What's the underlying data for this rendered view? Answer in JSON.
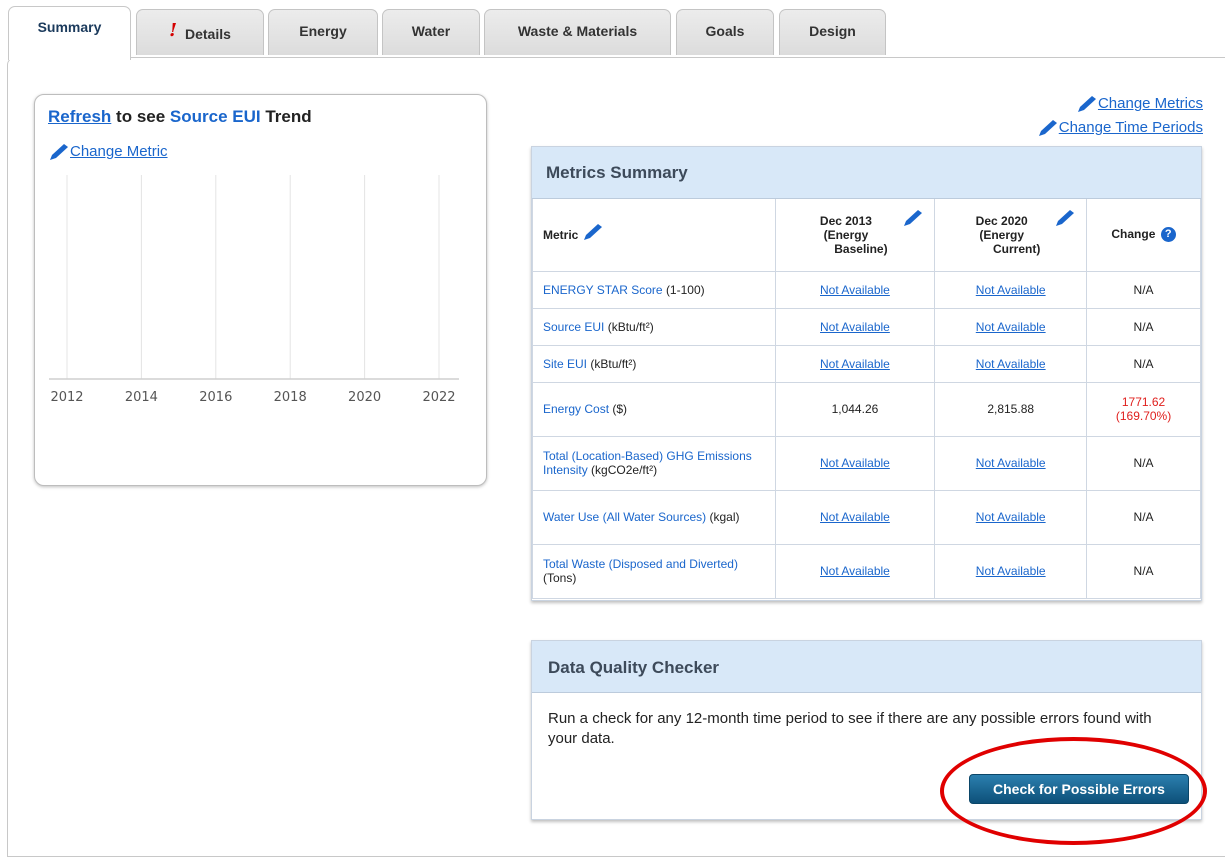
{
  "tabs": [
    {
      "label": "Summary",
      "active": true
    },
    {
      "label": "Details",
      "warning": "!"
    },
    {
      "label": "Energy"
    },
    {
      "label": "Water"
    },
    {
      "label": "Waste & Materials"
    },
    {
      "label": "Goals"
    },
    {
      "label": "Design"
    }
  ],
  "trend": {
    "refresh_link": "Refresh",
    "title_mid": "to see",
    "metric_name": "Source EUI",
    "title_end": "Trend",
    "change_metric": "Change Metric"
  },
  "chart_data": {
    "type": "line",
    "x_ticks": [
      "2012",
      "2014",
      "2016",
      "2018",
      "2020",
      "2022"
    ],
    "series": [],
    "grid": true
  },
  "top_links": {
    "change_metrics": "Change Metrics",
    "change_time_periods": "Change Time Periods"
  },
  "metrics_summary": {
    "title": "Metrics Summary",
    "headers": {
      "metric": "Metric",
      "baseline": [
        "Dec 2013",
        "(Energy",
        "Baseline)"
      ],
      "current": [
        "Dec 2020",
        "(Energy",
        "Current)"
      ],
      "change": "Change"
    },
    "rows": [
      {
        "name": "ENERGY STAR Score",
        "unit": "(1-100)",
        "baseline": "Not Available",
        "current": "Not Available",
        "change": "N/A"
      },
      {
        "name": "Source EUI",
        "unit": "(kBtu/ft²)",
        "baseline": "Not Available",
        "current": "Not Available",
        "change": "N/A"
      },
      {
        "name": "Site EUI",
        "unit": "(kBtu/ft²)",
        "baseline": "Not Available",
        "current": "Not Available",
        "change": "N/A"
      },
      {
        "name": "Energy Cost",
        "unit": "($)",
        "baseline": "1,044.26",
        "current": "2,815.88",
        "change_line1": "1771.62",
        "change_line2": "(169.70%)"
      },
      {
        "name": "Total (Location-Based) GHG Emissions Intensity",
        "unit": "(kgCO2e/ft²)",
        "baseline": "Not Available",
        "current": "Not Available",
        "change": "N/A"
      },
      {
        "name": "Water Use (All Water Sources)",
        "unit": "(kgal)",
        "baseline": "Not Available",
        "current": "Not Available",
        "change": "N/A"
      },
      {
        "name": "Total Waste (Disposed and Diverted)",
        "unit": "(Tons)",
        "baseline": "Not Available",
        "current": "Not Available",
        "change": "N/A"
      }
    ]
  },
  "data_quality": {
    "title": "Data Quality Checker",
    "description": "Run a check for any 12-month time period to see if there are any possible errors found with your data.",
    "button": "Check for Possible Errors"
  },
  "colors": {
    "link": "#1a66cc",
    "header_bg": "#d8e8f8",
    "button": "#0d5079",
    "negative_change": "#e0201e",
    "highlight_ellipse": "#e00000"
  }
}
